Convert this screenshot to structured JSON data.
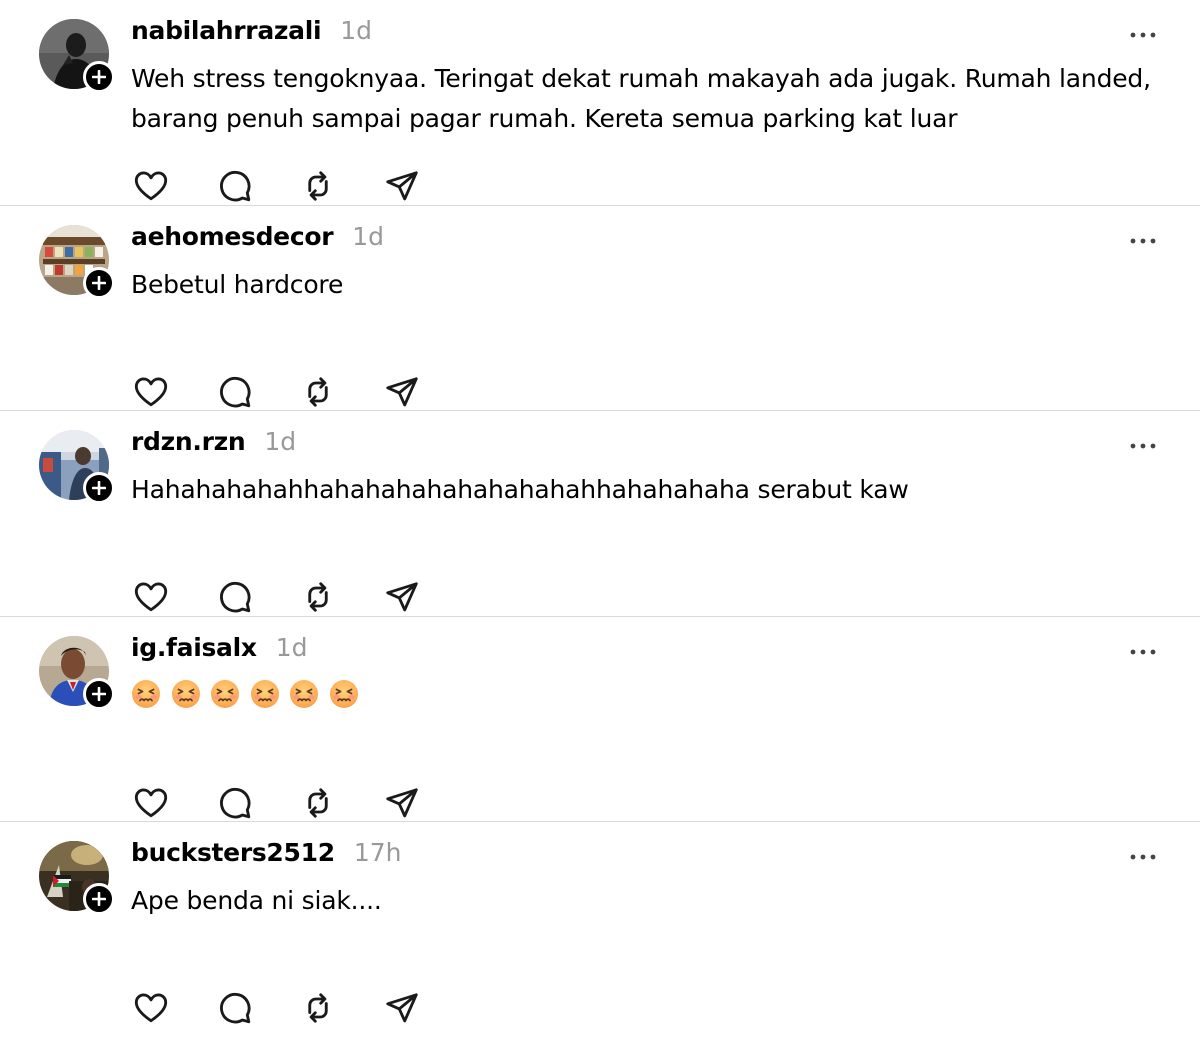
{
  "posts": [
    {
      "username": "nabilahrrazali",
      "timestamp": "1d",
      "text": "Weh stress tengoknyaa. Teringat dekat rumah makayah ada jugak. Rumah landed, barang penuh sampai pagar rumah. Kereta semua parking kat luar"
    },
    {
      "username": "aehomesdecor",
      "timestamp": "1d",
      "text": "Bebetul hardcore"
    },
    {
      "username": "rdzn.rzn",
      "timestamp": "1d",
      "text": "Hahahahahahhahahahahahahahahahhahahahaha serabut kaw"
    },
    {
      "username": "ig.faisalx",
      "timestamp": "1d",
      "text": "",
      "emoji_name": "tired-face-emoji",
      "emoji_count": 6
    },
    {
      "username": "bucksters2512",
      "timestamp": "17h",
      "text": "Ape benda ni siak...."
    }
  ],
  "icons": {
    "like": "heart-icon",
    "reply": "comment-bubble-icon",
    "repost": "repost-icon",
    "share": "send-icon",
    "more": "more-horizontal-icon",
    "follow": "plus-icon"
  },
  "colors": {
    "text": "#000000",
    "timestamp": "#999999",
    "divider": "#d9d9d9",
    "icon": "#1a1a1a",
    "follow_badge": "#000000"
  }
}
